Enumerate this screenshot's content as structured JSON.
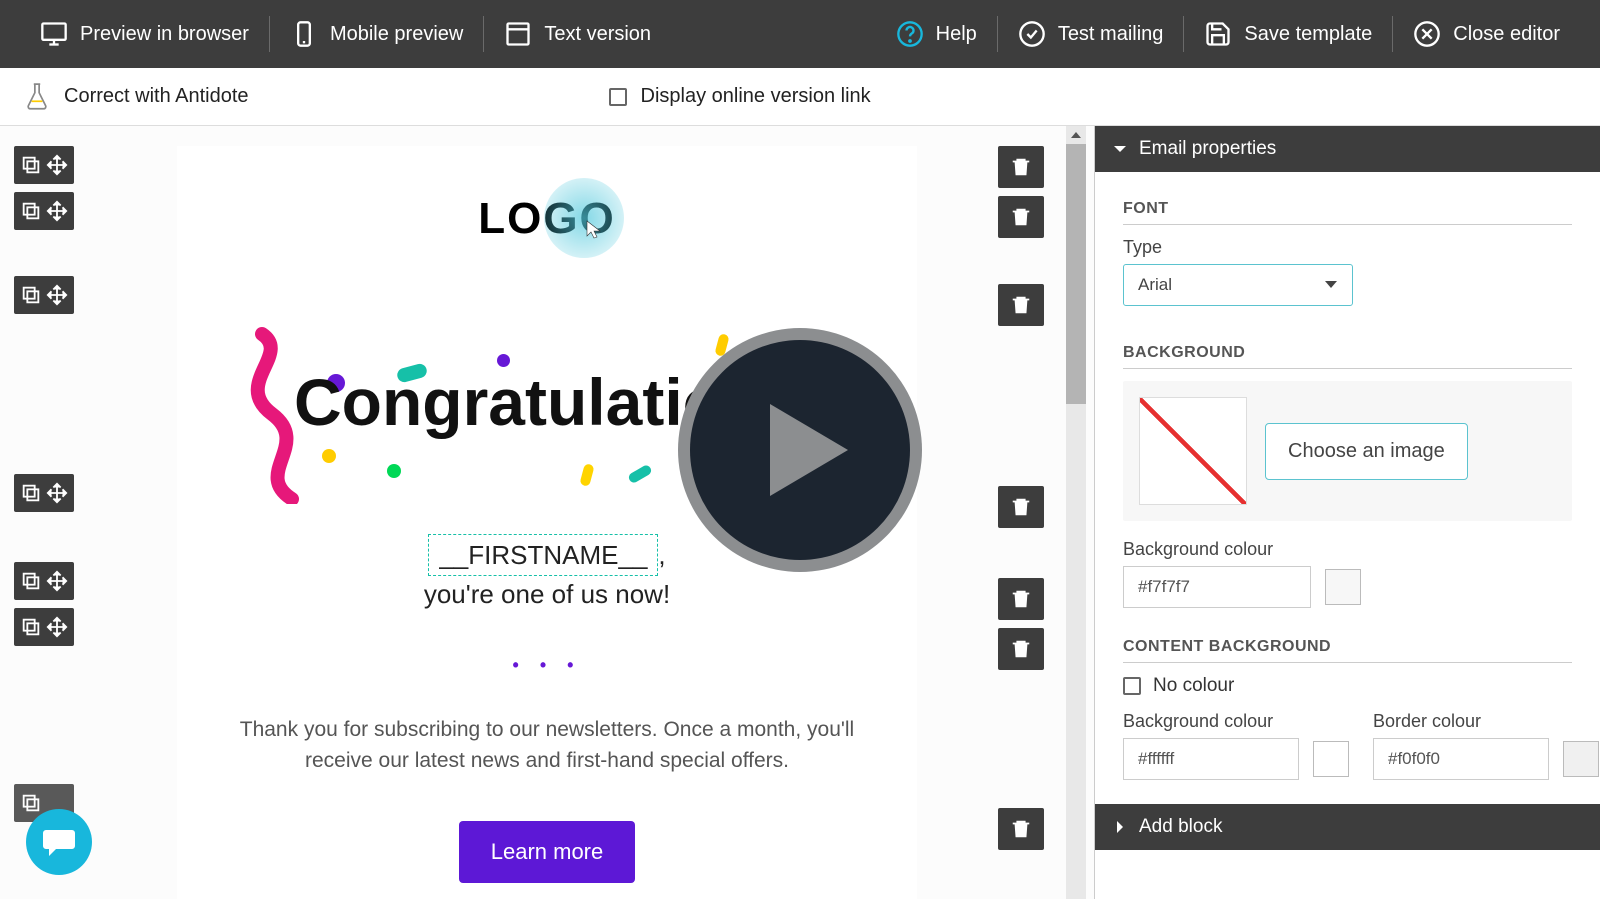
{
  "topbar": {
    "preview_browser": "Preview in browser",
    "mobile_preview": "Mobile preview",
    "text_version": "Text version",
    "help": "Help",
    "test_mailing": "Test mailing",
    "save_template": "Save template",
    "close_editor": "Close editor"
  },
  "subbar": {
    "antidote": "Correct with Antidote",
    "display_online": "Display online version link"
  },
  "email": {
    "logo": "LOGO",
    "congrats": "Congratulations",
    "firstname_token": "__FIRSTNAME__",
    "greeting_suffix": ",",
    "greeting_line2": "you're one of us now!",
    "dots": "• • •",
    "body": "Thank you for subscribing to our newsletters. Once a month, you'll receive our latest news and first-hand special offers.",
    "cta": "Learn more"
  },
  "panel": {
    "email_properties": "Email properties",
    "add_block": "Add block",
    "font_section": "FONT",
    "font_type_label": "Type",
    "font_type_value": "Arial",
    "background_section": "BACKGROUND",
    "choose_image": "Choose an image",
    "bg_colour_label": "Background colour",
    "bg_colour_value": "#f7f7f7",
    "content_bg_section": "CONTENT BACKGROUND",
    "no_colour": "No colour",
    "content_bg_colour_label": "Background colour",
    "content_bg_colour_value": "#ffffff",
    "border_colour_label": "Border colour",
    "border_colour_value": "#f0f0f0"
  }
}
